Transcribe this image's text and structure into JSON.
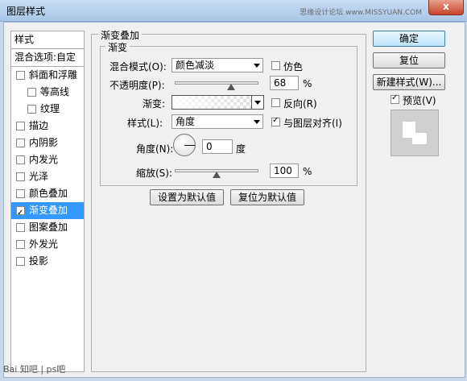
{
  "window": {
    "title": "图层样式",
    "watermark": "思缘设计论坛 www.MISSYUAN.COM",
    "close_glyph": "x"
  },
  "left_panel": {
    "header": "样式",
    "blend_options": "混合选项:自定",
    "items": [
      {
        "label": "斜面和浮雕",
        "checked": false
      },
      {
        "label": "等高线",
        "checked": false
      },
      {
        "label": "纹理",
        "checked": false
      },
      {
        "label": "描边",
        "checked": false
      },
      {
        "label": "内阴影",
        "checked": false
      },
      {
        "label": "内发光",
        "checked": false
      },
      {
        "label": "光泽",
        "checked": false
      },
      {
        "label": "颜色叠加",
        "checked": false
      },
      {
        "label": "渐变叠加",
        "checked": true
      },
      {
        "label": "图案叠加",
        "checked": false
      },
      {
        "label": "外发光",
        "checked": false
      },
      {
        "label": "投影",
        "checked": false
      }
    ]
  },
  "main": {
    "group_title": "渐变叠加",
    "sub_title": "渐变",
    "blend_mode": {
      "label": "混合模式(O):",
      "value": "颜色减淡"
    },
    "dither": {
      "label": "仿色",
      "checked": false
    },
    "opacity": {
      "label": "不透明度(P):",
      "value": "68",
      "unit": "%",
      "level": 0.68
    },
    "gradient": {
      "label": "渐变:"
    },
    "reverse": {
      "label": "反向(R)",
      "checked": false
    },
    "style": {
      "label": "样式(L):",
      "value": "角度"
    },
    "align": {
      "label": "与图层对齐(I)",
      "checked": true
    },
    "angle": {
      "label": "角度(N):",
      "value": "0",
      "unit": "度"
    },
    "scale": {
      "label": "缩放(S):",
      "value": "100",
      "unit": "%",
      "level": 0.5
    },
    "set_default": "设置为默认值",
    "reset_default": "复位为默认值"
  },
  "right_panel": {
    "ok": "确定",
    "reset": "复位",
    "new_style": "新建样式(W)...",
    "preview": {
      "label": "预览(V)",
      "checked": true
    }
  },
  "footer": "Bai 知吧 | ps吧"
}
